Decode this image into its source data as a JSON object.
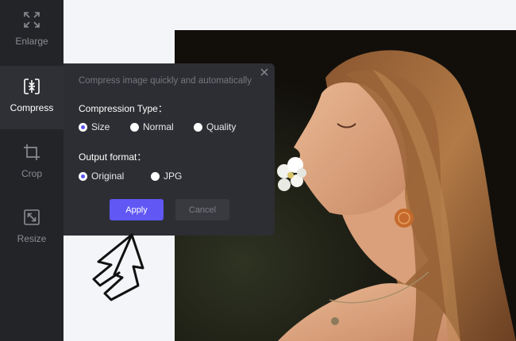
{
  "sidebar": {
    "items": [
      {
        "label": "Enlarge",
        "icon": "enlarge-icon",
        "active": false
      },
      {
        "label": "Compress",
        "icon": "compress-icon",
        "active": true
      },
      {
        "label": "Crop",
        "icon": "crop-icon",
        "active": false
      },
      {
        "label": "Resize",
        "icon": "resize-icon",
        "active": false
      }
    ]
  },
  "popup": {
    "subtitle": "Compress image quickly and automatically",
    "compression_type": {
      "label": "Compression Type：",
      "options": [
        "Size",
        "Normal",
        "Quality"
      ],
      "selected": "Size"
    },
    "output_format": {
      "label": "Output format：",
      "options": [
        "Original",
        "JPG"
      ],
      "selected": "Original"
    },
    "apply_label": "Apply",
    "cancel_label": "Cancel"
  },
  "colors": {
    "accent": "#6057f5",
    "sidebar_bg": "#232428",
    "popup_bg": "#2d2e33",
    "page_bg": "#f4f5f9"
  }
}
